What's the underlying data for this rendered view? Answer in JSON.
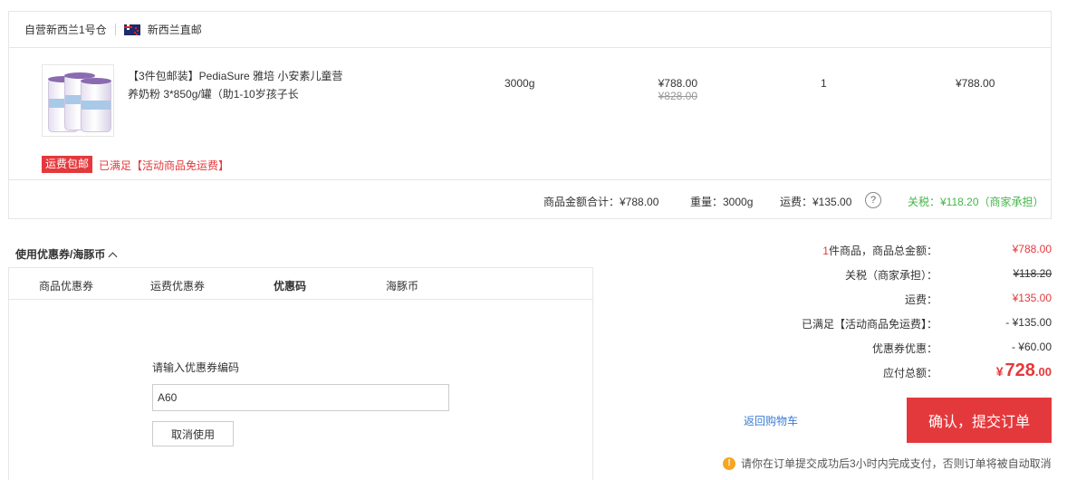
{
  "shop": {
    "warehouse": "自营新西兰1号仓",
    "origin": "新西兰直邮"
  },
  "product": {
    "title": "【3件包邮装】PediaSure 雅培 小安素儿童营养奶粉 3*850g/罐（助1-10岁孩子长",
    "weight": "3000g",
    "price": "¥788.00",
    "original_price": "¥828.00",
    "quantity": "1",
    "subtotal": "¥788.00"
  },
  "shipping": {
    "tag": "运费包邮",
    "note": "已满足【活动商品免运费】"
  },
  "summary": {
    "goods_total": "商品金额合计：¥788.00",
    "weight": "重量：3000g",
    "freight": "运费：¥135.00",
    "help": "?",
    "tax": "关税：¥118.20（商家承担）"
  },
  "coupon": {
    "title": "使用优惠券/海豚币",
    "tabs": [
      "商品优惠券",
      "运费优惠券",
      "优惠码",
      "海豚币"
    ],
    "active_tab": "优惠码",
    "code_label": "请输入优惠券编码",
    "code_value": "A60",
    "cancel_label": "取消使用"
  },
  "totals": {
    "count_prefix": "1",
    "goods_label": "件商品，商品总金额：",
    "goods_value": "¥788.00",
    "tax_label": "关税（商家承担）：",
    "tax_value": "¥118.20",
    "freight_label": "运费：",
    "freight_value": "¥135.00",
    "freight_free_label": "已满足【活动商品免运费】：",
    "freight_free_value": "- ¥135.00",
    "coupon_label": "优惠券优惠：",
    "coupon_value": "- ¥60.00",
    "payable_label": "应付总额：",
    "payable_symbol": "¥",
    "payable_int": "728",
    "payable_cents": ".00"
  },
  "actions": {
    "back": "返回购物车",
    "submit": "确认，提交订单",
    "warning": "请你在订单提交成功后3小时内完成支付，否则订单将被自动取消"
  },
  "colors": {
    "accent": "#e4393c",
    "link": "#3a7bd5",
    "tax_green": "#44b549",
    "warning": "#f5a623"
  }
}
